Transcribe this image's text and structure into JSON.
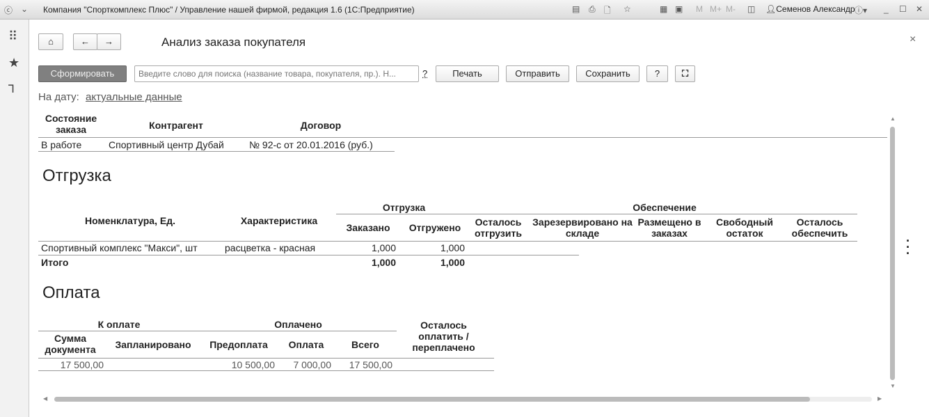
{
  "window": {
    "title": "Компания \"Спорткомплекс Плюс\" / Управление нашей фирмой, редакция 1.6  (1С:Предприятие)",
    "user": "Семенов Александр",
    "m_buttons": [
      "M",
      "M+",
      "M-"
    ]
  },
  "page": {
    "title": "Анализ заказа покупателя",
    "close": "×"
  },
  "toolbar": {
    "generate": "Сформировать",
    "search_placeholder": "Введите слово для поиска (название товара, покупателя, пр.). Н...",
    "search_help": "?",
    "print": "Печать",
    "send": "Отправить",
    "save": "Сохранить",
    "help": "?"
  },
  "date": {
    "label": "На дату:",
    "value": "актуальные данные"
  },
  "order": {
    "headers": [
      "Состояние заказа",
      "Контрагент",
      "Договор"
    ],
    "row": [
      "В работе",
      "Спортивный центр Дубай",
      "№ 92-с от 20.01.2016 (руб.)"
    ]
  },
  "shipment": {
    "title": "Отгрузка",
    "headers": {
      "item": "Номенклатура, Ед.",
      "char": "Характеристика",
      "group1": "Отгрузка",
      "ordered": "Заказано",
      "shipped": "Отгружено",
      "left_ship": "Осталось отгрузить",
      "group2": "Обеспечение",
      "reserved": "Зарезервировано на складе",
      "placed": "Размещено в заказах",
      "free": "Свободный остаток",
      "left_prov": "Осталось обеспечить"
    },
    "rows": [
      {
        "item": "Спортивный комплекс \"Макси\", шт",
        "char": "расцветка - красная",
        "ordered": "1,000",
        "shipped": "1,000"
      }
    ],
    "total": {
      "label": "Итого",
      "ordered": "1,000",
      "shipped": "1,000"
    }
  },
  "payment": {
    "title": "Оплата",
    "headers": {
      "to_pay": "К оплате",
      "paid": "Оплачено",
      "remain": "Осталось оплатить / переплачено",
      "doc_sum": "Сумма документа",
      "planned": "Запланировано",
      "prepay": "Предоплата",
      "pay": "Оплата",
      "total": "Всего"
    },
    "row": {
      "doc_sum": "17 500,00",
      "planned": "",
      "prepay": "10 500,00",
      "pay": "7 000,00",
      "total": "17 500,00",
      "remain": ""
    }
  }
}
